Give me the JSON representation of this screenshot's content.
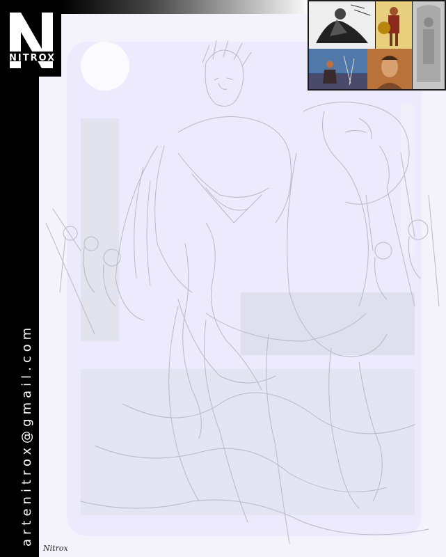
{
  "brand": {
    "logo_letter": "N",
    "name": "NITROX"
  },
  "contact": {
    "email": "artenitrox@gmail.com"
  },
  "signature": "Nitrox",
  "reference_images": [
    {
      "name": "ref-warrior-on-horse"
    },
    {
      "name": "ref-roman-soldier-color"
    },
    {
      "name": "ref-stone-relief"
    },
    {
      "name": "ref-battle-scene"
    },
    {
      "name": "ref-bust-portrait"
    }
  ],
  "colors": {
    "sidebar": "#000000",
    "canvas_bg": "#f4f3fb",
    "sketch_panel": "#e9e7fb",
    "sketch_line": "#b9b9c4"
  }
}
